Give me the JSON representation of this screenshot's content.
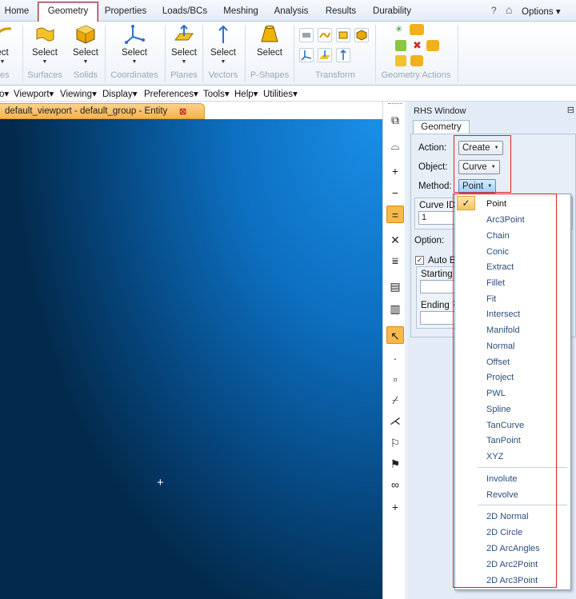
{
  "tabs": [
    "Home",
    "Geometry",
    "Properties",
    "Loads/BCs",
    "Meshing",
    "Analysis",
    "Results",
    "Durability"
  ],
  "active_tab": "Geometry",
  "options_label": "Options",
  "ribbon": {
    "buttons": [
      {
        "label": "ect",
        "group": "ves"
      },
      {
        "label": "Select",
        "group": "Surfaces"
      },
      {
        "label": "Select",
        "group": "Solids"
      },
      {
        "label": "Select",
        "group": "Coordinates"
      },
      {
        "label": "Select",
        "group": "Planes"
      },
      {
        "label": "Select",
        "group": "Vectors"
      },
      {
        "label": "Select",
        "group": "P-Shapes"
      }
    ],
    "transform_group": "Transform",
    "geometry_actions_group": "Geometry Actions"
  },
  "menubar": [
    "o",
    "Viewport",
    "Viewing",
    "Display",
    "Preferences",
    "Tools",
    "Help",
    "Utilities"
  ],
  "viewport_tab": {
    "title": "default_viewport - default_group - Entity",
    "close": "⊠"
  },
  "rhs": {
    "window_title": "RHS Window",
    "tab": "Geometry",
    "action_label": "Action:",
    "action_value": "Create",
    "object_label": "Object:",
    "object_value": "Curve",
    "method_label": "Method:",
    "method_value": "Point",
    "curve_id_label": "Curve ID",
    "curve_id_value": "1",
    "option_label": "Option:",
    "auto_label": "Auto Ex",
    "starting_label": "Starting I",
    "ending_label": "Ending Po"
  },
  "method_options_a": [
    "Point",
    "Arc3Point",
    "Chain",
    "Conic",
    "Extract",
    "Fillet",
    "Fit",
    "Intersect",
    "Manifold",
    "Normal",
    "Offset",
    "Project",
    "PWL",
    "Spline",
    "TanCurve",
    "TanPoint",
    "XYZ"
  ],
  "method_options_b": [
    "Involute",
    "Revolve"
  ],
  "method_options_c": [
    "2D Normal",
    "2D Circle",
    "2D ArcAngles",
    "2D Arc2Point",
    "2D Arc3Point"
  ],
  "colors": {
    "accent_orange": "#f7b94a",
    "highlight_red": "#e02020",
    "viewport_blue": "#0d6fc0"
  }
}
